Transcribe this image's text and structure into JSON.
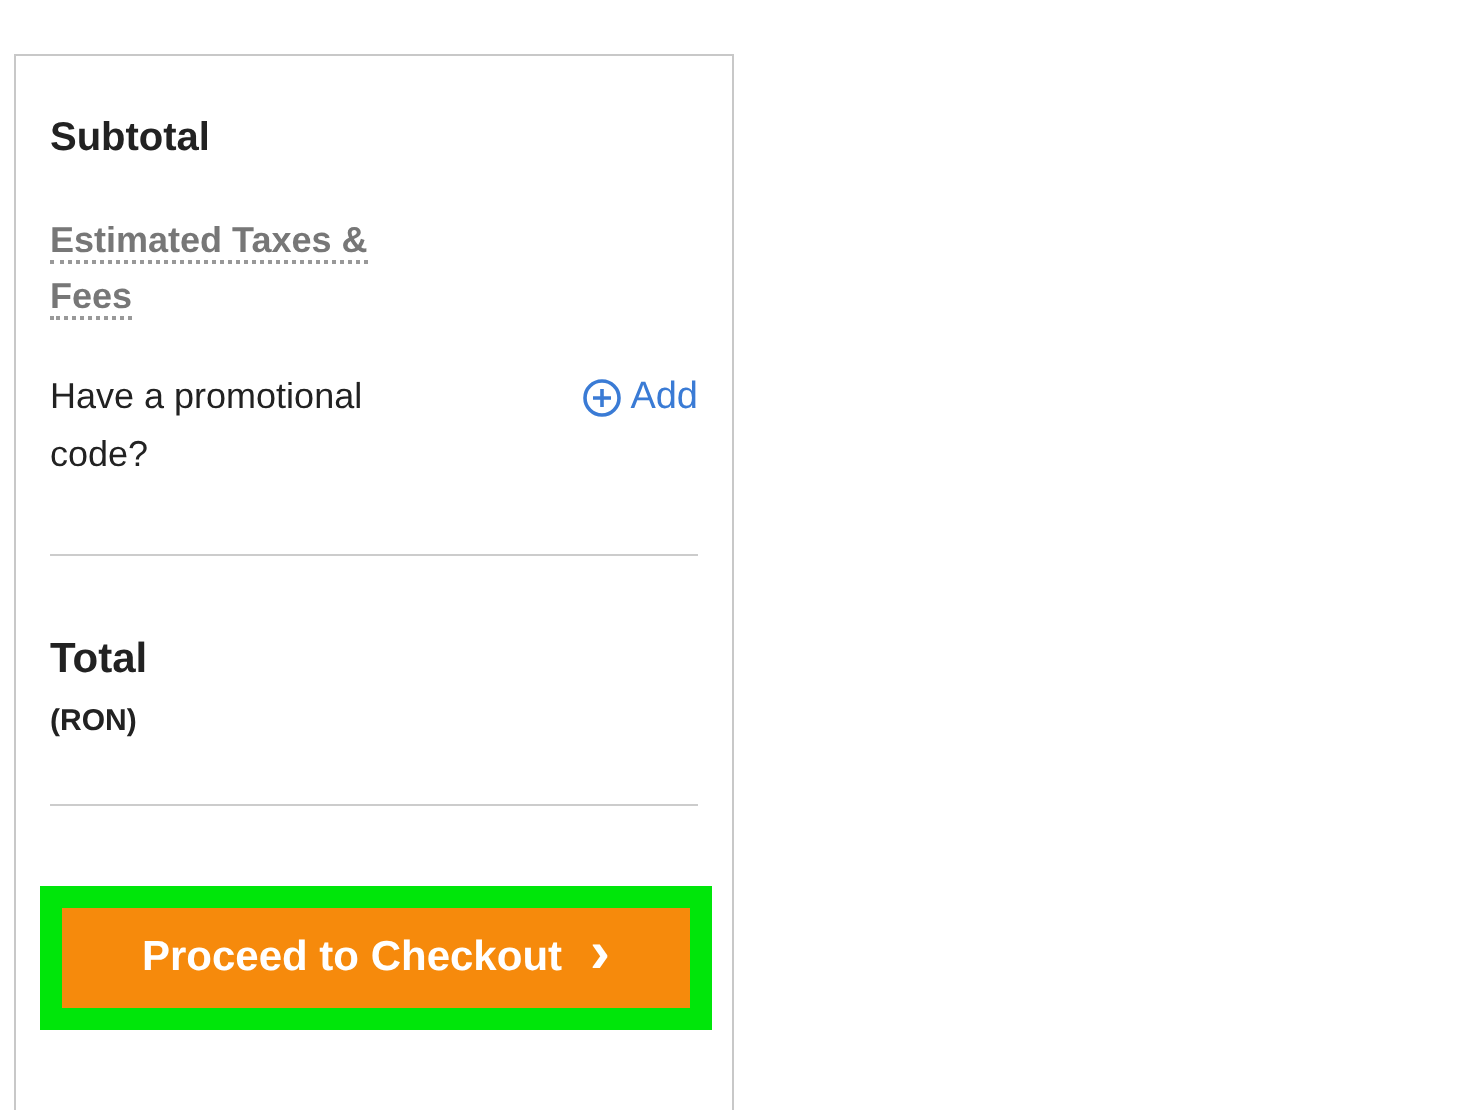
{
  "summary": {
    "subtotal_label": "Subtotal",
    "taxes_label": "Estimated Taxes & Fees",
    "promo_label": "Have a promotional code?",
    "promo_action": "Add",
    "total_label": "Total",
    "total_currency": "(RON)"
  },
  "checkout_button": {
    "label": "Proceed to Checkout",
    "icon": "›",
    "highlighted": true
  }
}
